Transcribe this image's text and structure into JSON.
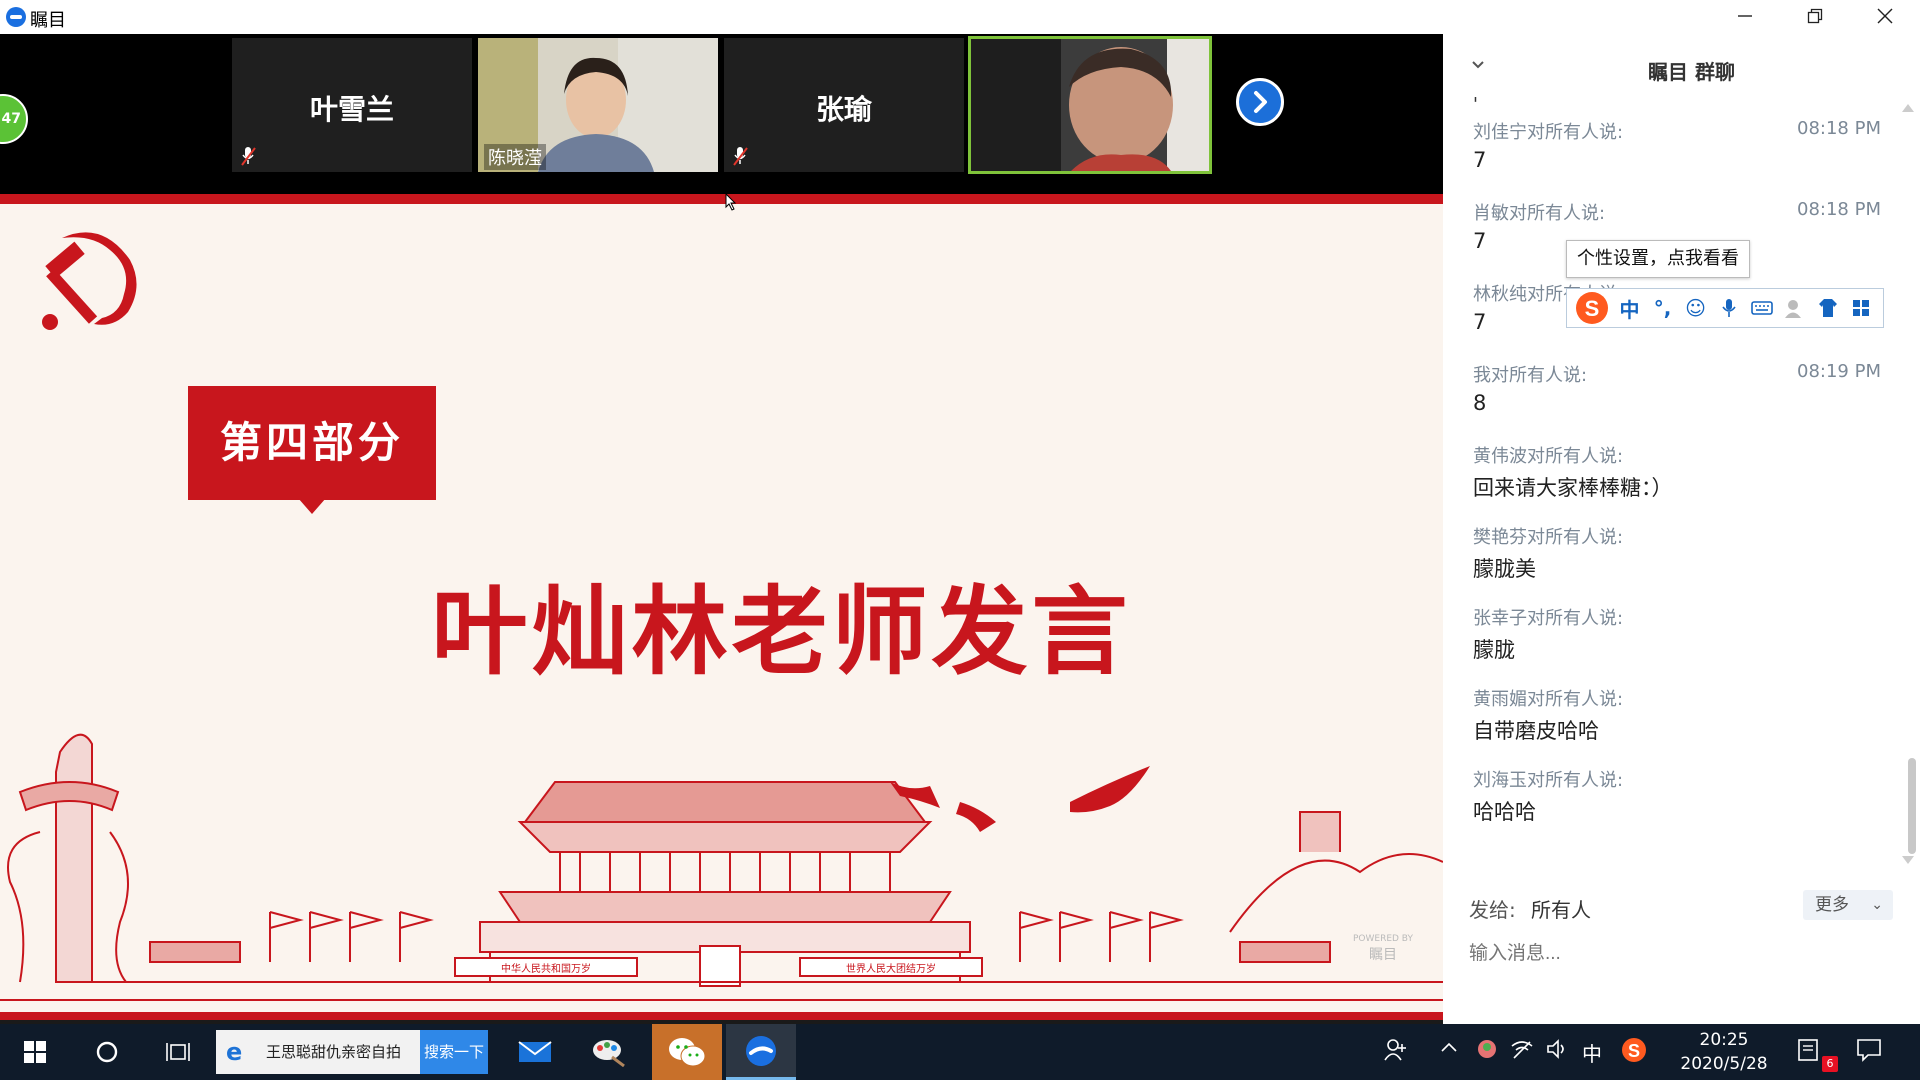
{
  "window": {
    "title": "瞩目",
    "minimize_icon": "minimize-icon",
    "restore_icon": "restore-icon",
    "close_icon": "close-icon"
  },
  "video_strip": {
    "participant_count_badge": "47",
    "tiles": [
      {
        "name": "叶雪兰",
        "video": false,
        "muted": true
      },
      {
        "name": "陈晓滢",
        "video": true,
        "muted": false
      },
      {
        "name": "张瑜",
        "video": false,
        "muted": true
      },
      {
        "name": "",
        "video": true,
        "muted": false,
        "active_speaker": true
      }
    ],
    "next_icon": "chevron-right-icon"
  },
  "slide": {
    "section_label": "第四部分",
    "title": "叶灿林老师发言",
    "banner_left": "中华人民共和国万岁",
    "banner_right": "世界人民大团结万岁",
    "powered_by": "POWERED BY",
    "powered_brand": "瞩目",
    "accent_color": "#c8161d",
    "background_color": "#fbf4ee"
  },
  "chat": {
    "title": "瞩目 群聊",
    "top_partial": "'",
    "messages": [
      {
        "sender": "刘佳宁对所有人说:",
        "time": "08:18 PM",
        "text": "7"
      },
      {
        "sender": "肖敏对所有人说:",
        "time": "08:18 PM",
        "text": "7"
      },
      {
        "sender": "林秋纯对所有人说:",
        "time": "",
        "text": "7"
      },
      {
        "sender": "我对所有人说:",
        "time": "08:19 PM",
        "text": "8"
      },
      {
        "sender": "黄伟波对所有人说:",
        "time": "",
        "text": "回来请大家棒棒糖：）"
      },
      {
        "sender": "樊艳芬对所有人说:",
        "time": "",
        "text": "朦胧美"
      },
      {
        "sender": "张幸子对所有人说:",
        "time": "",
        "text": "朦胧"
      },
      {
        "sender": "黄雨媚对所有人说:",
        "time": "",
        "text": "自带磨皮哈哈"
      },
      {
        "sender": "刘海玉对所有人说:",
        "time": "",
        "text": "哈哈哈"
      }
    ],
    "send_to_label": "发给:",
    "send_to_value": "所有人",
    "more_label": "更多",
    "input_placeholder": "输入消息..."
  },
  "ime": {
    "tooltip": "个性设置，点我看看",
    "items": [
      "sogou-logo-icon",
      "中",
      "°,",
      "emoji-icon",
      "microphone-icon",
      "keyboard-icon",
      "user-icon",
      "shirt-icon",
      "grid-icon"
    ]
  },
  "taskbar": {
    "search_text": "王思聪甜仇亲密自拍",
    "search_button": "搜索一下",
    "ime_mode": "中",
    "time": "20:25",
    "date": "2020/5/28",
    "notification_count": "6",
    "icons": [
      "windows-start-icon",
      "cortana-icon",
      "task-view-icon",
      "mail-icon",
      "paint-icon",
      "wechat-icon",
      "zhumu-icon"
    ]
  }
}
